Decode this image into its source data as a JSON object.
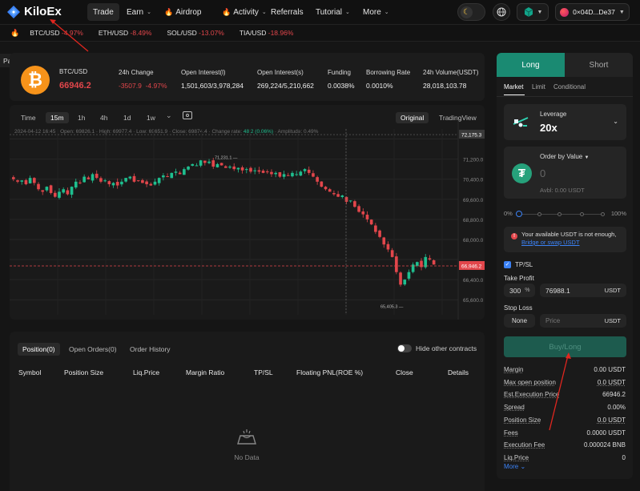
{
  "header": {
    "brand": "KiloEx",
    "nav": [
      {
        "label": "Trade",
        "active": true,
        "fire": false,
        "chevron": false
      },
      {
        "label": "Earn",
        "active": false,
        "fire": false,
        "chevron": true
      },
      {
        "label": "Airdrop",
        "active": false,
        "fire": true,
        "chevron": false
      },
      {
        "label": "Activity",
        "active": false,
        "fire": true,
        "chevron": true
      },
      {
        "label": "Referrals",
        "active": false,
        "fire": false,
        "chevron": false
      },
      {
        "label": "Tutorial",
        "active": false,
        "fire": false,
        "chevron": true
      },
      {
        "label": "More",
        "active": false,
        "fire": false,
        "chevron": true
      }
    ],
    "wallet": "0×04D...De37",
    "icons": [
      "moon-icon",
      "globe-icon",
      "network-cube-icon",
      "wallet-avatar-icon"
    ]
  },
  "ticker": [
    {
      "symbol": "BTC/USD",
      "change": "-4.97%"
    },
    {
      "symbol": "ETH/USD",
      "change": "-8.49%"
    },
    {
      "symbol": "SOL/USD",
      "change": "-13.07%"
    },
    {
      "symbol": "TIA/USD",
      "change": "-18.96%"
    }
  ],
  "pairs_button": "Pairs",
  "stats": {
    "pair": "BTC/USD",
    "price": "66946.2",
    "change_label": "24h Change",
    "change_abs": "-3507.9",
    "change_pct": "-4.97%",
    "oi_long_label": "Open Interest(l)",
    "oi_long": "1,501,603/3,978,284",
    "oi_short_label": "Open Interest(s)",
    "oi_short": "269,224/5,210,662",
    "funding_label": "Funding",
    "funding": "0.0038%",
    "borrow_label": "Borrowing Rate",
    "borrow": "0.0010%",
    "volume_label": "24h Volume(USDT)",
    "volume": "28,018,103.78"
  },
  "chart": {
    "timeframes": [
      "Time",
      "15m",
      "1h",
      "4h",
      "1d",
      "1w"
    ],
    "active_timeframe": "15m",
    "view_original": "Original",
    "view_tradingview": "TradingView",
    "ohlc_line": "2024-04-12 16:45 · Open: 69826.1 · High: 69977.4 · Low: 69651.9 · Close: 69874.4 · Change rate: ",
    "ohlc_change": "48.2 (0.06%)",
    "ohlc_amp": " · Amplitude: 0.49%",
    "crosshair_price": "72,175.3",
    "current_price": "66,946.2",
    "high_label": "71,231.1",
    "low_label": "65,405.3"
  },
  "chart_data": {
    "type": "candlestick",
    "ylim": [
      65000,
      72400
    ],
    "y_ticks": [
      72000,
      71200,
      70400,
      69600,
      68800,
      68000,
      67200,
      66400,
      65600
    ],
    "y_tick_labels": [
      "",
      "71,200.0",
      "70,400.0",
      "69,600.0",
      "68,800.0",
      "68,000.0",
      "",
      "66,400.0",
      "65,600.0"
    ],
    "annotations": {
      "high": 71231.1,
      "low": 65405.3,
      "last": 66946.2,
      "crosshair": 72175.3
    },
    "close_path": [
      70400,
      70300,
      70350,
      70200,
      70450,
      70250,
      70000,
      69900,
      70100,
      69850,
      69700,
      69900,
      70000,
      69800,
      70100,
      70300,
      70250,
      70500,
      70400,
      70600,
      70450,
      70300,
      70350,
      70200,
      70250,
      70150,
      70300,
      70450,
      70500,
      70300,
      70350,
      70250,
      70200,
      70150,
      70300,
      70450,
      70550,
      70500,
      70650,
      70700,
      70600,
      70800,
      70900,
      71000,
      70950,
      71150,
      71050,
      71100,
      70900,
      71000,
      70950,
      70850,
      70900,
      70800,
      70850,
      70750,
      70800,
      70700,
      70750,
      70700,
      70650,
      70700,
      70600,
      70650,
      70500,
      70600,
      70550,
      70650,
      70600,
      70700,
      70800,
      70650,
      70500,
      70300,
      70100,
      70000,
      69900,
      69800,
      69700,
      69750,
      69500,
      69550,
      69300,
      69100,
      69000,
      68800,
      68600,
      68300,
      68100,
      67800,
      67600,
      67300,
      66700,
      66200,
      66400,
      66700,
      67000,
      67100,
      66900,
      67300,
      67200,
      67000
    ]
  },
  "positions": {
    "tabs": [
      "Position(0)",
      "Open Orders(0)",
      "Order History"
    ],
    "hide_label": "Hide other contracts",
    "columns": [
      "Symbol",
      "Position Size",
      "Liq.Price",
      "Margin Ratio",
      "TP/SL",
      "Floating PNL(ROE %)",
      "Close",
      "Details"
    ],
    "empty": "No Data"
  },
  "order": {
    "long": "Long",
    "short": "Short",
    "types": [
      "Market",
      "Limit",
      "Conditional"
    ],
    "leverage_label": "Leverage",
    "leverage": "20x",
    "value_label": "Order by Value",
    "value": "0",
    "avbl": "Avbl: 0.00 USDT",
    "slider_min": "0%",
    "slider_max": "100%",
    "warning_pre": "Your available USDT is not enough,",
    "warning_link": "Bridge or swap USDT",
    "tpsl": "TP/SL",
    "take_profit": "Take Profit",
    "tp_pct": "300",
    "tp_pct_unit": "%",
    "tp_price": "76988.1",
    "tp_unit": "USDT",
    "stop_loss": "Stop Loss",
    "sl_none": "None",
    "sl_placeholder": "Price",
    "sl_unit": "USDT",
    "submit": "Buy/Long",
    "details": [
      {
        "label": "Margin",
        "value": "0.00 USDT"
      },
      {
        "label": "Max open position",
        "value": "0.0 USDT"
      },
      {
        "label": "Est.Execution Price",
        "value": "66946.2"
      },
      {
        "label": "Spread",
        "value": "0.00%"
      },
      {
        "label": "Position Size",
        "value": "0.0 USDT"
      },
      {
        "label": "Fees",
        "value": "0.0000 USDT"
      },
      {
        "label": "Execution Fee",
        "value": "0.000024 BNB"
      },
      {
        "label": "Liq.Price",
        "value": "0"
      }
    ],
    "more": "More"
  },
  "colors": {
    "up": "#1fbf8f",
    "down": "#e2464b",
    "accent": "#1a8a72",
    "annotation": "#e0261f"
  }
}
